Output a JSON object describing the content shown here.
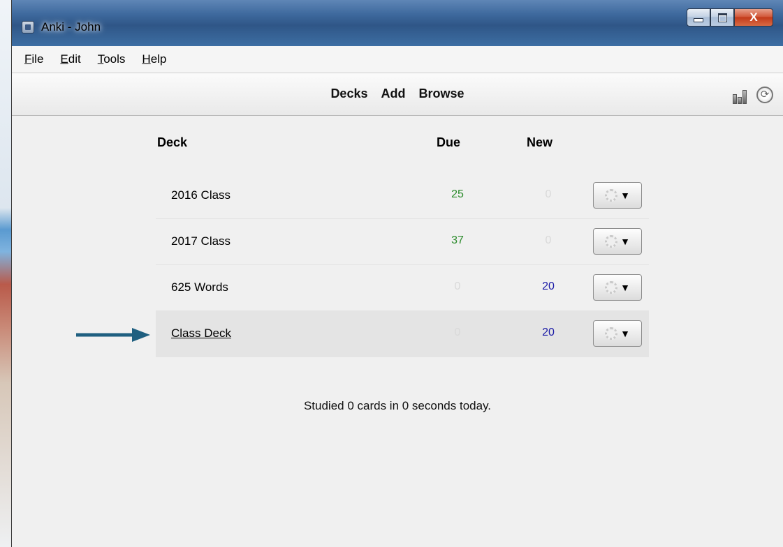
{
  "window": {
    "title": "Anki - John",
    "controls": {
      "close_glyph": "X"
    }
  },
  "menu": {
    "items": [
      {
        "label": "File",
        "access": "F",
        "rest": "ile"
      },
      {
        "label": "Edit",
        "access": "E",
        "rest": "dit"
      },
      {
        "label": "Tools",
        "access": "T",
        "rest": "ools"
      },
      {
        "label": "Help",
        "access": "H",
        "rest": "elp"
      }
    ]
  },
  "toolbar": {
    "decks": "Decks",
    "add": "Add",
    "browse": "Browse",
    "icons": [
      "stats-icon",
      "sync-icon"
    ]
  },
  "deck_list": {
    "headers": {
      "deck": "Deck",
      "due": "Due",
      "new": "New"
    },
    "rows": [
      {
        "name": "2016 Class",
        "due": "25",
        "new": "0"
      },
      {
        "name": "2017 Class",
        "due": "37",
        "new": "0"
      },
      {
        "name": "625 Words",
        "due": "0",
        "new": "20"
      },
      {
        "name": "Class Deck",
        "due": "0",
        "new": "20",
        "current": true
      }
    ],
    "options_caret": "▼"
  },
  "footer": {
    "studied": "Studied 0 cards in 0 seconds today."
  },
  "colors": {
    "due": "#2a8a2a",
    "new": "#1a1aa6",
    "zero": "#d9d9d9",
    "arrow": "#1f5f80"
  }
}
